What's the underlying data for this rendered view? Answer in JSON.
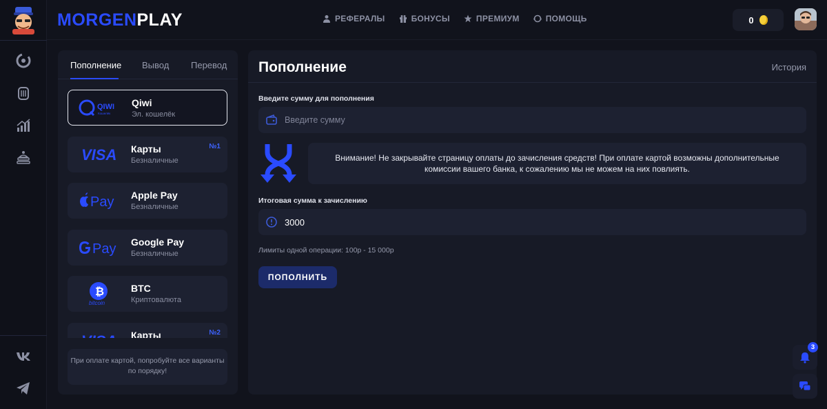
{
  "brand": {
    "part1": "MORGEN",
    "part2": "PLAY"
  },
  "nav": [
    {
      "label": "РЕФЕРАЛЫ",
      "icon": "user-icon"
    },
    {
      "label": "БОНУСЫ",
      "icon": "gift-icon"
    },
    {
      "label": "ПРЕМИУМ",
      "icon": "star-icon"
    },
    {
      "label": "ПОМОЩЬ",
      "icon": "support-icon"
    }
  ],
  "balance": {
    "value": "0",
    "icon": "coin-icon"
  },
  "rail": {
    "icons": [
      "spinner-icon",
      "jar-icon",
      "chart-icon",
      "stack-icon"
    ],
    "social": [
      "vk-icon",
      "telegram-icon"
    ]
  },
  "tabs": [
    "Пополнение",
    "Вывод",
    "Перевод"
  ],
  "methods": [
    {
      "name": "Qiwi",
      "sub": "Эл. кошелёк",
      "badge": "",
      "logo": "qiwi-logo"
    },
    {
      "name": "Карты",
      "sub": "Безналичные",
      "badge": "№1",
      "logo": "visa-logo"
    },
    {
      "name": "Apple Pay",
      "sub": "Безналичные",
      "badge": "",
      "logo": "apple-pay-logo"
    },
    {
      "name": "Google Pay",
      "sub": "Безналичные",
      "badge": "",
      "logo": "google-pay-logo"
    },
    {
      "name": "BTC",
      "sub": "Криптовалюта",
      "badge": "",
      "logo": "bitcoin-logo"
    },
    {
      "name": "Карты",
      "sub": "",
      "badge": "№2",
      "logo": "visa-logo"
    }
  ],
  "logo_text": {
    "qiwi": "QIWI",
    "qiwi_sub": "Кошелёк",
    "visa": "VISA",
    "apple_pay": "Pay",
    "google_pay": "Pay",
    "bitcoin": "bitcoin"
  },
  "method_note": "При оплате картой, попробуйте все варианты по порядку!",
  "form": {
    "title": "Пополнение",
    "history": "История",
    "amount_label": "Введите сумму для пополнения",
    "amount_placeholder": "Введите сумму",
    "warning": "Внимание! Не закрывайте страницу оплаты до зачисления средств! При оплате картой возможны дополнительные комиссии вашего банка, к сожалению мы не можем на них повлиять.",
    "total_label": "Итоговая сумма к зачислению",
    "total_value": "3000",
    "limits": "Лимиты одной операции: 100р - 15 000р",
    "submit": "ПОПОЛНИТЬ"
  },
  "notifications": {
    "count": "3"
  },
  "colors": {
    "accent": "#2a4bff",
    "bg": "#11131c",
    "panel": "#171a26",
    "card": "#1d2131"
  }
}
